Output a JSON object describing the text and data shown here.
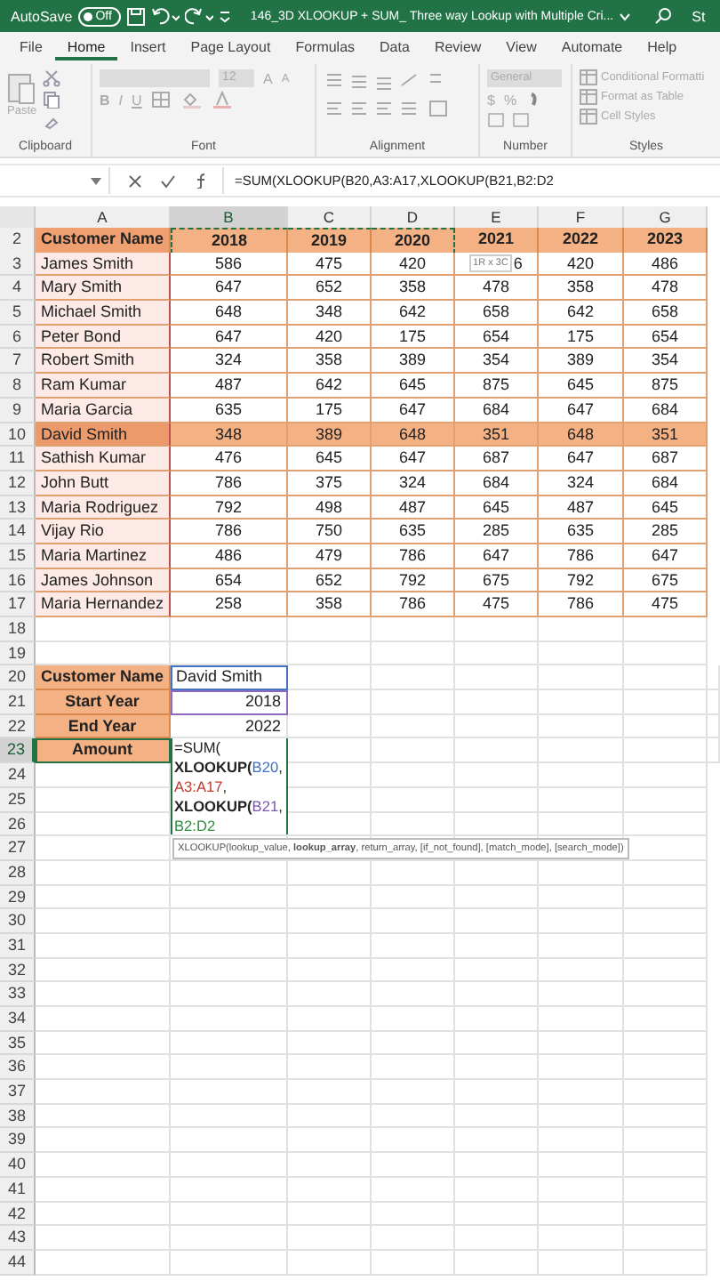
{
  "title_bar": {
    "autosave_label": "AutoSave",
    "autosave": {
      "on": false,
      "label": "Off"
    },
    "title": "146_3D XLOOKUP + SUM_ Three way Lookup with Multiple Cri...",
    "cut_text": "St"
  },
  "menu_tabs": [
    {
      "label": "File",
      "selected": false
    },
    {
      "label": "Home",
      "selected": true
    },
    {
      "label": "Insert",
      "selected": false
    },
    {
      "label": "Page Layout",
      "selected": false
    },
    {
      "label": "Formulas",
      "selected": false
    },
    {
      "label": "Data",
      "selected": false
    },
    {
      "label": "Review",
      "selected": false
    },
    {
      "label": "View",
      "selected": false
    },
    {
      "label": "Automate",
      "selected": false
    },
    {
      "label": "Help",
      "selected": false
    }
  ],
  "ribbon": {
    "disabled": true,
    "groups": [
      {
        "kind": "clipboard",
        "label": "Clipboard",
        "paste": "Paste"
      },
      {
        "kind": "font",
        "label": "Font",
        "size": "12",
        "grow": "A",
        "shrink": "A",
        "bold": "B",
        "italic": "I",
        "underline": "U"
      },
      {
        "kind": "alignment",
        "label": "Alignment"
      },
      {
        "kind": "number",
        "label": "Number",
        "format": "General",
        "currency": "$",
        "percent": "%"
      },
      {
        "kind": "styles",
        "label": "Styles",
        "items": [
          "Conditional Formatti",
          "Format as Table",
          "Cell Styles"
        ]
      }
    ]
  },
  "formula_bar": {
    "formula": "=SUM(XLOOKUP(B20,A3:A17,XLOOKUP(B21,B2:D2"
  },
  "sheet": {
    "columns": [
      {
        "label": "A",
        "selected": false
      },
      {
        "label": "B",
        "selected": true
      },
      {
        "label": "C",
        "selected": false
      },
      {
        "label": "D",
        "selected": false
      },
      {
        "label": "E",
        "selected": false
      },
      {
        "label": "F",
        "selected": false
      },
      {
        "label": "G",
        "selected": false
      }
    ],
    "range_tip": "1R x 3C",
    "rows": [
      {
        "row": "2",
        "kind": "header",
        "selected": false,
        "cells": [
          {
            "text": "Customer Name",
            "copied": false
          },
          {
            "text": "2018",
            "copied": true
          },
          {
            "text": "2019",
            "copied": true
          },
          {
            "text": "2020",
            "copied": true
          },
          {
            "text": "2021",
            "copied": false
          },
          {
            "text": "2022",
            "copied": false
          },
          {
            "text": "2023",
            "copied": false
          }
        ]
      },
      {
        "row": "3",
        "kind": "data",
        "selected": false,
        "highlighted": false,
        "cells": [
          "James Smith",
          "586",
          "475",
          "420",
          "6",
          "420",
          "486"
        ]
      },
      {
        "row": "4",
        "kind": "data",
        "selected": false,
        "highlighted": false,
        "cells": [
          "Mary Smith",
          "647",
          "652",
          "358",
          "478",
          "358",
          "478"
        ]
      },
      {
        "row": "5",
        "kind": "data",
        "selected": false,
        "highlighted": false,
        "cells": [
          "Michael Smith",
          "648",
          "348",
          "642",
          "658",
          "642",
          "658"
        ]
      },
      {
        "row": "6",
        "kind": "data",
        "selected": false,
        "highlighted": false,
        "cells": [
          "Peter Bond",
          "647",
          "420",
          "175",
          "654",
          "175",
          "654"
        ]
      },
      {
        "row": "7",
        "kind": "data",
        "selected": false,
        "highlighted": false,
        "cells": [
          "Robert Smith",
          "324",
          "358",
          "389",
          "354",
          "389",
          "354"
        ]
      },
      {
        "row": "8",
        "kind": "data",
        "selected": false,
        "highlighted": false,
        "cells": [
          "Ram Kumar",
          "487",
          "642",
          "645",
          "875",
          "645",
          "875"
        ]
      },
      {
        "row": "9",
        "kind": "data",
        "selected": false,
        "highlighted": false,
        "cells": [
          "Maria Garcia",
          "635",
          "175",
          "647",
          "684",
          "647",
          "684"
        ]
      },
      {
        "row": "10",
        "kind": "data",
        "selected": false,
        "highlighted": true,
        "cells": [
          "David Smith",
          "348",
          "389",
          "648",
          "351",
          "648",
          "351"
        ]
      },
      {
        "row": "11",
        "kind": "data",
        "selected": false,
        "highlighted": false,
        "cells": [
          "Sathish Kumar",
          "476",
          "645",
          "647",
          "687",
          "647",
          "687"
        ]
      },
      {
        "row": "12",
        "kind": "data",
        "selected": false,
        "highlighted": false,
        "cells": [
          "John Butt",
          "786",
          "375",
          "324",
          "684",
          "324",
          "684"
        ]
      },
      {
        "row": "13",
        "kind": "data",
        "selected": false,
        "highlighted": false,
        "cells": [
          "Maria Rodriguez",
          "792",
          "498",
          "487",
          "645",
          "487",
          "645"
        ]
      },
      {
        "row": "14",
        "kind": "data",
        "selected": false,
        "highlighted": false,
        "cells": [
          "Vijay Rio",
          "786",
          "750",
          "635",
          "285",
          "635",
          "285"
        ]
      },
      {
        "row": "15",
        "kind": "data",
        "selected": false,
        "highlighted": false,
        "cells": [
          "Maria Martinez",
          "486",
          "479",
          "786",
          "647",
          "786",
          "647"
        ]
      },
      {
        "row": "16",
        "kind": "data",
        "selected": false,
        "highlighted": false,
        "cells": [
          "James Johnson",
          "654",
          "652",
          "792",
          "675",
          "792",
          "675"
        ]
      },
      {
        "row": "17",
        "kind": "data",
        "selected": false,
        "highlighted": false,
        "cells": [
          "Maria Hernandez",
          "258",
          "358",
          "786",
          "475",
          "786",
          "475"
        ]
      },
      {
        "row": "18",
        "kind": "empty",
        "selected": false
      },
      {
        "row": "19",
        "kind": "empty",
        "selected": false
      },
      {
        "row": "20",
        "kind": "input",
        "selected": false,
        "label": "Customer Name",
        "value": "David Smith",
        "numeric": false,
        "color": "#4472c4"
      },
      {
        "row": "21",
        "kind": "input",
        "selected": false,
        "label": "Start Year",
        "value": "2018",
        "numeric": true,
        "color": "#8e6bbf"
      },
      {
        "row": "22",
        "kind": "input",
        "selected": false,
        "label": "End Year",
        "value": "2022",
        "numeric": true
      },
      {
        "row": "23",
        "kind": "formula",
        "selected": true,
        "label": "Amount",
        "lines": [
          [
            {
              "text": "=SUM(",
              "kind": "plain"
            }
          ],
          [
            {
              "text": "XLOOKUP(",
              "kind": "function"
            },
            {
              "text": "B20",
              "kind": "ref",
              "color": "#3d6fc2"
            },
            {
              "text": ",",
              "kind": "plain"
            }
          ],
          [
            {
              "text": "A3:A17",
              "kind": "ref",
              "color": "#c0392b"
            },
            {
              "text": ",",
              "kind": "plain"
            }
          ],
          [
            {
              "text": "XLOOKUP(",
              "kind": "function"
            },
            {
              "text": "B21",
              "kind": "ref",
              "color": "#7d54b0"
            },
            {
              "text": ",",
              "kind": "plain"
            }
          ],
          [
            {
              "text": "B2:D2",
              "kind": "ref",
              "color": "#2e8b3e"
            }
          ]
        ]
      },
      {
        "row": "24",
        "kind": "empty",
        "selected": false
      },
      {
        "row": "25",
        "kind": "empty",
        "selected": false
      },
      {
        "row": "26",
        "kind": "empty",
        "selected": false
      },
      {
        "row": "27",
        "kind": "empty",
        "selected": false
      },
      {
        "row": "28",
        "kind": "empty",
        "selected": false
      },
      {
        "row": "29",
        "kind": "empty",
        "selected": false
      },
      {
        "row": "30",
        "kind": "empty",
        "selected": false
      },
      {
        "row": "31",
        "kind": "empty",
        "selected": false
      },
      {
        "row": "32",
        "kind": "empty",
        "selected": false
      },
      {
        "row": "33",
        "kind": "empty",
        "selected": false
      },
      {
        "row": "34",
        "kind": "empty",
        "selected": false
      },
      {
        "row": "35",
        "kind": "empty",
        "selected": false
      },
      {
        "row": "36",
        "kind": "empty",
        "selected": false
      },
      {
        "row": "37",
        "kind": "empty",
        "selected": false
      },
      {
        "row": "38",
        "kind": "empty",
        "selected": false
      },
      {
        "row": "39",
        "kind": "empty",
        "selected": false
      },
      {
        "row": "40",
        "kind": "empty",
        "selected": false
      },
      {
        "row": "41",
        "kind": "empty",
        "selected": false
      },
      {
        "row": "42",
        "kind": "empty",
        "selected": false
      },
      {
        "row": "43",
        "kind": "empty",
        "selected": false
      },
      {
        "row": "44",
        "kind": "empty",
        "selected": false
      }
    ],
    "tooltip": "XLOOKUP(lookup_value, **lookup_array**, return_array, [if_not_found], [match_mode], [search_mode])"
  }
}
